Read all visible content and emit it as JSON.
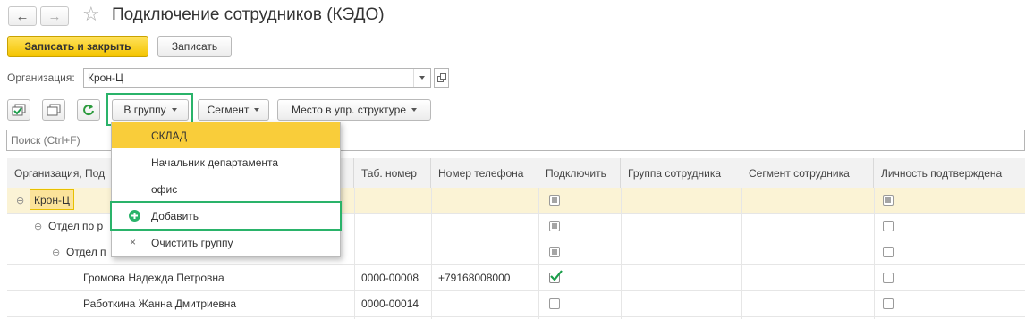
{
  "window": {
    "title": "Подключение сотрудников (КЭДО)"
  },
  "nav": {
    "back_icon": "←",
    "forward_icon": "→",
    "star_icon": "☆"
  },
  "toolbar": {
    "save_close_label": "Записать и закрыть",
    "save_label": "Записать"
  },
  "org": {
    "label": "Организация:",
    "value": "Крон-Ц"
  },
  "actions": {
    "group_label": "В группу",
    "segment_label": "Сегмент",
    "place_label": "Место в упр. структуре"
  },
  "search": {
    "placeholder": "Поиск (Ctrl+F)"
  },
  "table": {
    "headers": [
      "Организация, Под",
      "Таб. номер",
      "Номер телефона",
      "Подключить",
      "Группа сотрудника",
      "Сегмент сотрудника",
      "Личность подтверждена"
    ],
    "rows": [
      {
        "name": "Крон-Ц",
        "tab": "",
        "phone": "",
        "connect": "indeterminate",
        "verified": "indeterminate"
      },
      {
        "name": "Отдел по р",
        "tab": "",
        "phone": "",
        "connect": "indeterminate",
        "verified": "unchecked"
      },
      {
        "name": "Отдел п",
        "tab": "",
        "phone": "",
        "connect": "indeterminate",
        "verified": "unchecked"
      },
      {
        "name": "Громова Надежда Петровна",
        "tab": "0000-00008",
        "phone": "+79168008000",
        "connect": "checked",
        "verified": "unchecked"
      },
      {
        "name": "Работкина Жанна Дмитриевна",
        "tab": "0000-00014",
        "phone": "",
        "connect": "unchecked",
        "verified": "unchecked"
      }
    ]
  },
  "menu": {
    "items": [
      "СКЛАД",
      "Начальник департамента",
      "офис",
      "Добавить",
      "Очистить группу"
    ],
    "clear_icon": "×"
  },
  "colors": {
    "accent_yellow": "#f4c400",
    "highlight_green": "#2ab36a",
    "selected_row": "#fbf3d5",
    "menu_selected": "#f9cd3a"
  }
}
